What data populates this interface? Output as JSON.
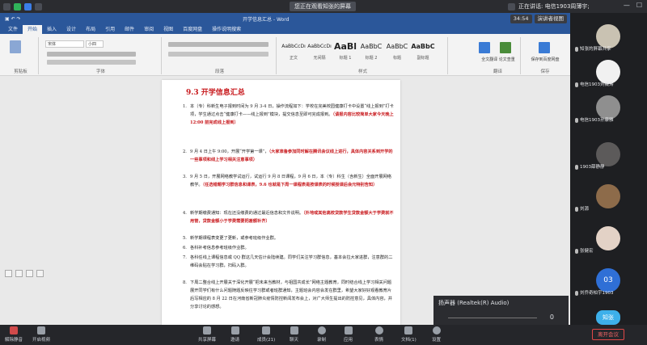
{
  "topbar": {
    "viewer_label": "您正在观看知张的屏幕",
    "speaking": "正在讲话: 电信1903周薄宇;",
    "minimize": "—",
    "maximize": "☐"
  },
  "share_controls": {
    "time": "34:54",
    "view_mode": "演讲者视图"
  },
  "word": {
    "title": "开学信息汇总 - Word",
    "tabs": [
      "文件",
      "开始",
      "插入",
      "设计",
      "布局",
      "引用",
      "邮件",
      "审阅",
      "视图",
      "百度网盘",
      "操作说明搜索"
    ],
    "font_name": "宋体",
    "font_size": "小四",
    "groups": [
      "剪贴板",
      "字体",
      "段落",
      "样式",
      "翻译",
      "保存"
    ],
    "styles": [
      {
        "preview": "AaBbCcDı",
        "name": "正文"
      },
      {
        "preview": "AaBbCcDı",
        "name": "无间隔"
      },
      {
        "preview": "AaBl",
        "name": "标题 1"
      },
      {
        "preview": "AaBbC",
        "name": "标题 2"
      },
      {
        "preview": "AaBbC",
        "name": "标题"
      },
      {
        "preview": "AaBbC",
        "name": "副标题"
      }
    ],
    "right_buttons": [
      "全文翻译",
      "论文查重",
      "保存到百度网盘"
    ]
  },
  "document": {
    "heading": "9.3  开学信息汇总",
    "items": [
      {
        "num": "1.",
        "text": "本（专）科新生电子报到时间为 9 月 3-4 日，操作流程如下：学校在完美校园健康打卡中设置“线上报到”打卡项，学生通过点击“健康打卡——线上报到”模块，提交信息至即可完成报到。",
        "red": "（请报内容比较简单大家今天晚上 12:00 前完成线上报到）"
      },
      {
        "num": "2.",
        "text": "9 月 4 日上午 9:00，开展“开学第一课”，",
        "red": "（大家准备参加同时解在腾讯会议线上进行，具体内容关系到开学的一些事项和线上学习相关注意事项）"
      },
      {
        "num": "3.",
        "text": "9 月 5 日，开展网络教学试运行，试运行 9 月 8 日课程，9 月 6 日，本（专）科生（含新生）全面开展网络教学。",
        "red": "（任选错题学习群信息和课表，9.6 也就是下周一课程表是按课表的时候授课后会元特别告知）"
      },
      {
        "num": "4.",
        "text": "新学期缴费通知：现在还没缴费的通过最近信息和文件说明。",
        "red": "（外地或其他高校贷款学生贷款金额大于学费就不用管，贷款金额小于学费需要把差额补齐）"
      },
      {
        "num": "5.",
        "text": "新学期课程表变更了更新，或参考班级作业群。",
        "red": ""
      },
      {
        "num": "6.",
        "text": "各科补考信息参考班级作业群。",
        "red": ""
      },
      {
        "num": "7.",
        "text": "各科任线上课程信息或 QQ 群这几天估计会陆续建。同学们关注学习群信息，基本会拉大家进群，注意群的二维码会贴在学习群，扫码入群。",
        "red": ""
      },
      {
        "num": "8.",
        "text": "下周二整合线上开展关于深化开展“把未来当教材，与祖国共成长”网络主题教育，同时结合线上学习相关问题展开同学们有什么问题随题反映往学习群或者班群通知，主题班会内容会发在群里，希望大家好好观看教育片后写相应的 8 月 22 日在河南省新冠肺炎疫情防控新闻发布会上，对广大师生提出的防控意见，具体内容，并分享讨论的感想。",
        "red": ""
      }
    ],
    "zoom_tools": [
      "□",
      "□",
      "□",
      "□"
    ]
  },
  "audio": {
    "title": "扬声器 (Realtek(R) Audio)",
    "value": "0"
  },
  "participants": [
    {
      "name": "知张的屏幕共享",
      "color": "#c9c2b2"
    },
    {
      "name": "电信1903刘薇涛",
      "color": "#f1f1f1"
    },
    {
      "name": "电信1903孙康雅",
      "color": "#8f8f8f"
    },
    {
      "name": "1903薛静静",
      "color": "#5c5a5a"
    },
    {
      "name": "刘源",
      "color": "#8d6b4a"
    },
    {
      "name": "张健宏",
      "color": "#e3d2c6"
    },
    {
      "name": "刘乔奇柏宇1903",
      "color": "#2f6fd6",
      "badge": "03"
    },
    {
      "name": "知张",
      "color": "#3db0ea"
    }
  ],
  "toolbar": {
    "items": [
      "解除静音",
      "开启视频",
      "共享屏幕",
      "邀请",
      "成员(21)",
      "聊天",
      "录制",
      "应用",
      "表情",
      "文档(1)",
      "设置"
    ],
    "leave": "离开会议"
  }
}
